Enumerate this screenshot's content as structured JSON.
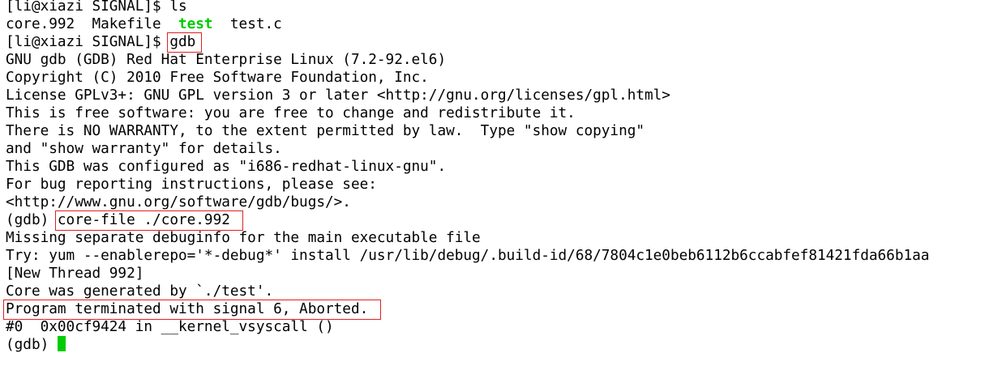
{
  "terminal": {
    "l1": "[li@xiazi SIGNAL]$ ls",
    "l2_a": "core.992  Makefile  ",
    "l2_exec": "test",
    "l2_b": "  test.c",
    "l3_prompt": "[li@xiazi SIGNAL]$ ",
    "l3_cmd": "gdb",
    "l4": "GNU gdb (GDB) Red Hat Enterprise Linux (7.2-92.el6)",
    "l5": "Copyright (C) 2010 Free Software Foundation, Inc.",
    "l6": "License GPLv3+: GNU GPL version 3 or later <http://gnu.org/licenses/gpl.html>",
    "l7": "This is free software: you are free to change and redistribute it.",
    "l8": "There is NO WARRANTY, to the extent permitted by law.  Type \"show copying\"",
    "l9": "and \"show warranty\" for details.",
    "l10": "This GDB was configured as \"i686-redhat-linux-gnu\".",
    "l11": "For bug reporting instructions, please see:",
    "l12": "<http://www.gnu.org/software/gdb/bugs/>.",
    "l13_prompt": "(gdb) ",
    "l13_cmd": "core-file ./core.992",
    "l14": "Missing separate debuginfo for the main executable file",
    "l15": "Try: yum --enablerepo='*-debug*' install /usr/lib/debug/.build-id/68/7804c1e0beb6112b6ccabfef81421fda66b1aa",
    "l16": "[New Thread 992]",
    "l17": "Core was generated by `./test'.",
    "l18": "Program terminated with signal 6, Aborted.",
    "l19": "#0  0x00cf9424 in __kernel_vsyscall ()",
    "l20_prompt": "(gdb) "
  },
  "colors": {
    "executable": "#00cc00",
    "cursor": "#00cc00",
    "highlight_box": "#e02020"
  }
}
